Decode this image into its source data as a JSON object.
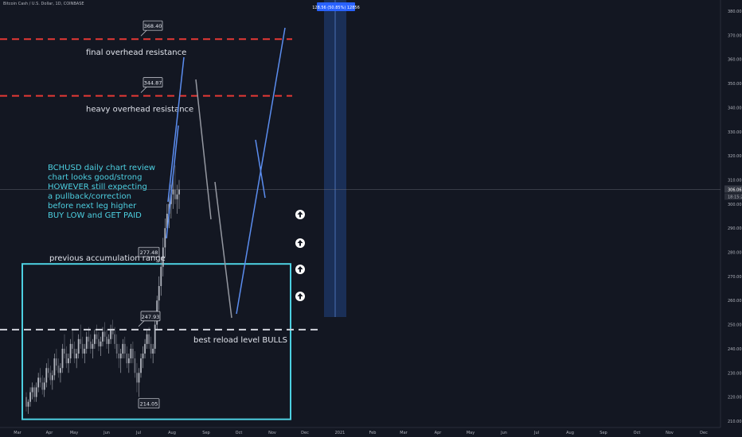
{
  "header": {
    "symbol": "Bitcoin Cash / U.S. Dollar, 1D, COINBASE"
  },
  "colors": {
    "background": "#131722",
    "resistance": "#e53935",
    "support": "#d1d4dc",
    "box": "#4dd0e1",
    "note": "#4dd0e1",
    "projection_up": "#5b8def",
    "projection_down": "#9598a1",
    "measure": "#1e3a6e",
    "measure_label": "#2962ff",
    "text": "#e0e3eb"
  },
  "chart_data": {
    "type": "candlestick",
    "x_ticks": [
      "Mar",
      "Apr",
      "May",
      "Jun",
      "Jul",
      "Aug",
      "Sep",
      "Oct",
      "Nov",
      "Dec",
      "2021",
      "Feb",
      "Mar",
      "Apr",
      "May",
      "Jun",
      "Jul",
      "Aug",
      "Sep",
      "Oct",
      "Nov",
      "Dec"
    ],
    "y_ticks": [
      "380.00",
      "370.00",
      "360.00",
      "350.00",
      "340.00",
      "330.00",
      "320.00",
      "310.00",
      "300.00",
      "290.00",
      "280.00",
      "270.00",
      "260.00",
      "250.00",
      "240.00",
      "230.00",
      "220.00",
      "210.00"
    ],
    "y_range": [
      210,
      380
    ],
    "current_price": "306.06",
    "countdown": "18:15:21",
    "levels": [
      {
        "price": 368.4,
        "label": "368.40",
        "note": "final overhead resistance",
        "style": "resistance"
      },
      {
        "price": 344.87,
        "label": "344.87",
        "note": "heavy overhead resistance",
        "style": "resistance"
      },
      {
        "price": 247.93,
        "label": "247.93",
        "note": "best reload level BULLS",
        "style": "support"
      }
    ],
    "box": {
      "top": 277.48,
      "bottom": 214.05,
      "top_label": "277.48",
      "bottom_label": "214.05",
      "note": "previous accumulation range"
    },
    "notes": [
      "BCHUSD daily chart review",
      "chart looks good/strong",
      "HOWEVER still expecting",
      "a pullback/correction",
      "before next leg higher",
      "BUY LOW and GET PAID"
    ],
    "measure_label": "128.56 (50.85%) 12856",
    "candles": [
      [
        220,
        222,
        214,
        216
      ],
      [
        216,
        219,
        213,
        218
      ],
      [
        218,
        224,
        216,
        222
      ],
      [
        222,
        226,
        219,
        224
      ],
      [
        224,
        225,
        218,
        220
      ],
      [
        220,
        226,
        218,
        224
      ],
      [
        224,
        230,
        222,
        228
      ],
      [
        228,
        232,
        224,
        226
      ],
      [
        226,
        229,
        221,
        223
      ],
      [
        223,
        228,
        220,
        226
      ],
      [
        226,
        234,
        224,
        232
      ],
      [
        232,
        236,
        228,
        230
      ],
      [
        230,
        233,
        225,
        227
      ],
      [
        227,
        231,
        223,
        229
      ],
      [
        229,
        238,
        227,
        236
      ],
      [
        236,
        240,
        231,
        233
      ],
      [
        233,
        236,
        228,
        230
      ],
      [
        230,
        234,
        226,
        232
      ],
      [
        232,
        242,
        230,
        240
      ],
      [
        240,
        246,
        236,
        238
      ],
      [
        238,
        241,
        232,
        234
      ],
      [
        234,
        238,
        230,
        236
      ],
      [
        236,
        244,
        234,
        242
      ],
      [
        242,
        248,
        238,
        240
      ],
      [
        240,
        243,
        234,
        236
      ],
      [
        236,
        240,
        232,
        238
      ],
      [
        238,
        246,
        236,
        244
      ],
      [
        244,
        250,
        240,
        242
      ],
      [
        242,
        245,
        236,
        238
      ],
      [
        238,
        242,
        234,
        240
      ],
      [
        240,
        247,
        238,
        245
      ],
      [
        245,
        249,
        240,
        243
      ],
      [
        243,
        246,
        238,
        240
      ],
      [
        240,
        244,
        236,
        242
      ],
      [
        242,
        248,
        240,
        246
      ],
      [
        246,
        250,
        242,
        244
      ],
      [
        244,
        247,
        239,
        241
      ],
      [
        241,
        245,
        237,
        243
      ],
      [
        243,
        249,
        241,
        247
      ],
      [
        247,
        251,
        243,
        245
      ],
      [
        245,
        248,
        240,
        242
      ],
      [
        242,
        246,
        238,
        244
      ],
      [
        244,
        250,
        242,
        248
      ],
      [
        248,
        252,
        244,
        246
      ],
      [
        246,
        249,
        240,
        242
      ],
      [
        242,
        246,
        236,
        238
      ],
      [
        238,
        242,
        232,
        236
      ],
      [
        236,
        240,
        230,
        238
      ],
      [
        238,
        244,
        236,
        242
      ],
      [
        242,
        245,
        236,
        238
      ],
      [
        238,
        241,
        232,
        234
      ],
      [
        234,
        238,
        230,
        236
      ],
      [
        236,
        242,
        234,
        240
      ],
      [
        240,
        243,
        234,
        236
      ],
      [
        236,
        239,
        228,
        230
      ],
      [
        230,
        234,
        222,
        226
      ],
      [
        226,
        232,
        220,
        230
      ],
      [
        230,
        238,
        228,
        236
      ],
      [
        236,
        241,
        232,
        238
      ],
      [
        238,
        244,
        236,
        242
      ],
      [
        242,
        248,
        240,
        246
      ],
      [
        246,
        249,
        240,
        242
      ],
      [
        242,
        245,
        236,
        238
      ],
      [
        238,
        242,
        234,
        240
      ],
      [
        240,
        252,
        238,
        250
      ],
      [
        250,
        262,
        248,
        260
      ],
      [
        260,
        270,
        256,
        266
      ],
      [
        266,
        278,
        262,
        274
      ],
      [
        274,
        286,
        270,
        282
      ],
      [
        282,
        294,
        278,
        290
      ],
      [
        290,
        300,
        286,
        296
      ],
      [
        296,
        304,
        290,
        300
      ],
      [
        300,
        308,
        294,
        304
      ],
      [
        304,
        312,
        298,
        306
      ],
      [
        306,
        316,
        300,
        302
      ],
      [
        302,
        308,
        296,
        304
      ],
      [
        304,
        310,
        298,
        306
      ]
    ],
    "projection_up": [
      [
        211,
        254,
        231,
        72
      ],
      [
        209,
        300,
        224,
        158
      ],
      [
        297,
        395,
        358,
        35
      ],
      [
        333,
        249,
        321,
        176
      ]
    ],
    "projection_down": [
      [
        246,
        100,
        265,
        276
      ],
      [
        270,
        229,
        291,
        400
      ]
    ]
  }
}
